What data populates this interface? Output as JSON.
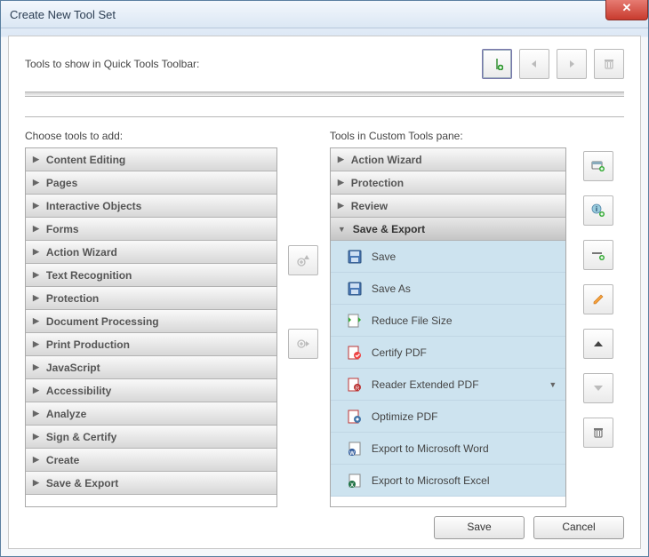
{
  "window": {
    "title": "Create New Tool Set"
  },
  "top": {
    "label": "Tools to show in Quick Tools Toolbar:"
  },
  "left": {
    "label": "Choose tools to add:",
    "categories": [
      {
        "label": "Content Editing"
      },
      {
        "label": "Pages"
      },
      {
        "label": "Interactive Objects"
      },
      {
        "label": "Forms"
      },
      {
        "label": "Action Wizard"
      },
      {
        "label": "Text Recognition"
      },
      {
        "label": "Protection"
      },
      {
        "label": "Document Processing"
      },
      {
        "label": "Print Production"
      },
      {
        "label": "JavaScript"
      },
      {
        "label": "Accessibility"
      },
      {
        "label": "Analyze"
      },
      {
        "label": "Sign & Certify"
      },
      {
        "label": "Create"
      },
      {
        "label": "Save & Export"
      }
    ]
  },
  "right": {
    "label": "Tools in Custom Tools pane:",
    "categories": [
      {
        "label": "Action Wizard",
        "expanded": false
      },
      {
        "label": "Protection",
        "expanded": false
      },
      {
        "label": "Review",
        "expanded": false
      },
      {
        "label": "Save & Export",
        "expanded": true
      }
    ],
    "save_export_items": [
      {
        "label": "Save",
        "icon": "floppy"
      },
      {
        "label": "Save As",
        "icon": "floppy"
      },
      {
        "label": "Reduce File Size",
        "icon": "reduce"
      },
      {
        "label": "Certify PDF",
        "icon": "certify"
      },
      {
        "label": "Reader Extended PDF",
        "icon": "reader",
        "submenu": true
      },
      {
        "label": "Optimize PDF",
        "icon": "optimize"
      },
      {
        "label": "Export to Microsoft Word",
        "icon": "word"
      },
      {
        "label": "Export to Microsoft Excel",
        "icon": "excel"
      }
    ]
  },
  "footer": {
    "save": "Save",
    "cancel": "Cancel"
  }
}
